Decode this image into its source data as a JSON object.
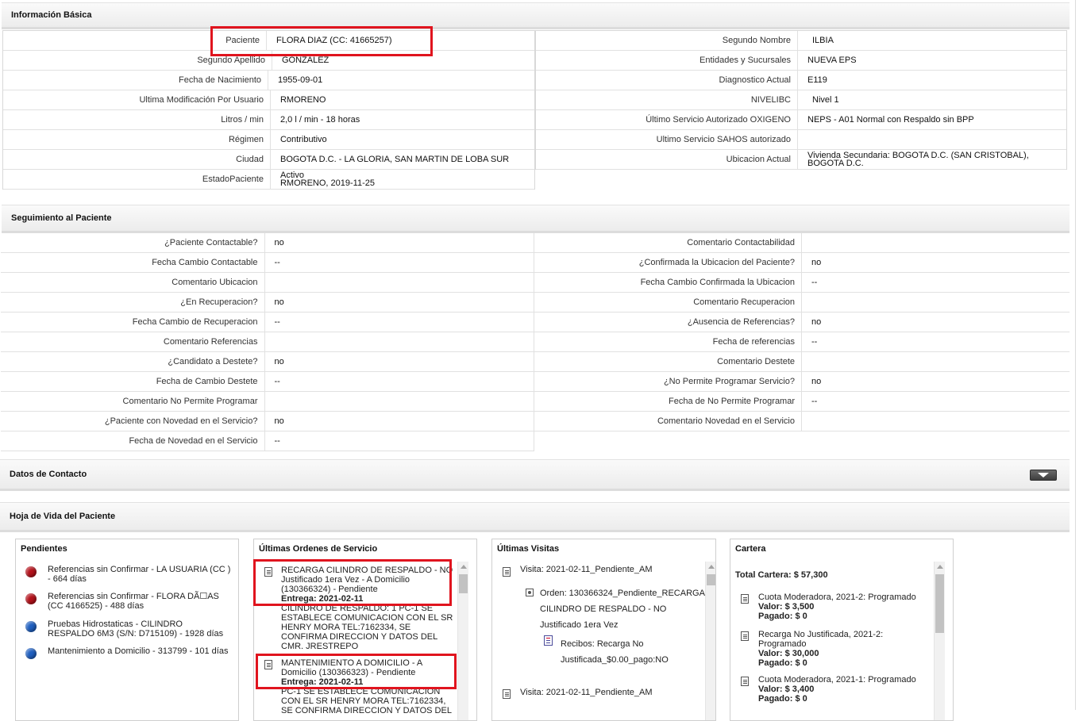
{
  "sections": {
    "basic_info": "Información Básica",
    "follow_up": "Seguimiento al Paciente",
    "contact": "Datos de Contacto",
    "history": "Hoja de Vida del Paciente"
  },
  "basic_info": {
    "left": [
      {
        "label": "Paciente",
        "value": "FLORA DIAZ (CC: 41665257)"
      },
      {
        "label": "Segundo Apellido",
        "value": "GONZALEZ"
      },
      {
        "label": "Fecha de Nacimiento",
        "value": "1955-09-01"
      },
      {
        "label": "Ultima Modificación Por Usuario",
        "value": "RMORENO"
      },
      {
        "label": "Litros / min",
        "value": "2,0 l / min - 18 horas"
      },
      {
        "label": "Régimen",
        "value": "Contributivo"
      },
      {
        "label": "Ciudad",
        "value": "BOGOTA D.C. - LA GLORIA, SAN MARTIN DE LOBA SUR"
      },
      {
        "label": "EstadoPaciente",
        "value_line1": "Activo",
        "value_line2": "RMORENO, 2019-11-25"
      }
    ],
    "right": [
      {
        "label": "Segundo Nombre",
        "value": "ILBIA"
      },
      {
        "label": "Entidades y Sucursales",
        "value": "NUEVA EPS"
      },
      {
        "label": "Diagnostico Actual",
        "value": "E119"
      },
      {
        "label": "NIVELIBC",
        "value": "Nivel 1"
      },
      {
        "label": "Último Servicio Autorizado OXIGENO",
        "value": "NEPS - A01 Normal con Respaldo sin BPP"
      },
      {
        "label": "Ultimo Servicio SAHOS autorizado",
        "value": ""
      },
      {
        "label": "Ubicacion Actual",
        "value_line1": "Vivienda Secundaria: BOGOTA D.C. (SAN CRISTOBAL),",
        "value_line2": "BOGOTA D.C."
      }
    ]
  },
  "follow_up": {
    "left": [
      {
        "label": "¿Paciente Contactable?",
        "value": "no"
      },
      {
        "label": "Fecha Cambio Contactable",
        "value": "--"
      },
      {
        "label": "Comentario Ubicacion",
        "value": ""
      },
      {
        "label": "¿En Recuperacion?",
        "value": "no"
      },
      {
        "label": "Fecha Cambio de Recuperacion",
        "value": "--"
      },
      {
        "label": "Comentario Referencias",
        "value": ""
      },
      {
        "label": "¿Candidato a Destete?",
        "value": "no"
      },
      {
        "label": "Fecha de Cambio Destete",
        "value": "--"
      },
      {
        "label": "Comentario No Permite Programar",
        "value": ""
      },
      {
        "label": "¿Paciente con Novedad en el Servicio?",
        "value": "no"
      },
      {
        "label": "Fecha de Novedad en el Servicio",
        "value": "--"
      }
    ],
    "right": [
      {
        "label": "Comentario Contactabilidad",
        "value": ""
      },
      {
        "label": "¿Confirmada la Ubicacion del Paciente?",
        "value": "no"
      },
      {
        "label": "Fecha Cambio Confirmada la Ubicacion",
        "value": "--"
      },
      {
        "label": "Comentario Recuperacion",
        "value": ""
      },
      {
        "label": "¿Ausencia de Referencias?",
        "value": "no"
      },
      {
        "label": "Fecha de referencias",
        "value": "--"
      },
      {
        "label": "Comentario Destete",
        "value": ""
      },
      {
        "label": "¿No Permite Programar Servicio?",
        "value": "no"
      },
      {
        "label": "Fecha de No Permite Programar",
        "value": "--"
      },
      {
        "label": "Comentario Novedad en el Servicio",
        "value": ""
      }
    ]
  },
  "cards": {
    "pendientes": {
      "title": "Pendientes",
      "items": [
        {
          "color": "#b3121b",
          "text": "Referencias sin Confirmar - LA USUARIA (CC ) - 664 días"
        },
        {
          "color": "#b3121b",
          "text": "Referencias sin Confirmar - FLORA DÃ☐AS (CC 4166525) - 488 días"
        },
        {
          "color": "#1f5fbf",
          "text": "Pruebas Hidrostaticas - CILINDRO RESPALDO 6M3 (S/N: D715109) - 1928 días"
        },
        {
          "color": "#1f5fbf",
          "text": "Mantenimiento a Domicilio - 313799 - 101 días"
        }
      ]
    },
    "ordenes": {
      "title": "Últimas Ordenes de Servicio",
      "items": [
        {
          "text": "RECARGA CILINDRO DE RESPALDO - NO Justificado 1era Vez - A Domicilio (130366324) - Pendiente",
          "delivery": "Entrega: 2021-02-11",
          "extra": "CILINDRO DE RESPALDO: 1 PC-1 SE ESTABLECE COMUNICACION CON EL SR HENRY MORA TEL:7162334, SE CONFIRMA DIRECCION Y DATOS DEL CMR. JRESTREPO"
        },
        {
          "text": "MANTENIMIENTO A DOMICILIO - A Domicilio (130366323) - Pendiente",
          "delivery": "Entrega: 2021-02-11",
          "extra": "PC-1 SE ESTABLECE COMUNICACION CON EL SR HENRY MORA TEL:7162334, SE CONFIRMA DIRECCION Y DATOS DEL"
        }
      ]
    },
    "visitas": {
      "title": "Últimas Visitas",
      "visit1": "Visita: 2021-02-11_Pendiente_AM",
      "order_line1": "Orden: 130366324_Pendiente_RECARGA",
      "order_line2": "CILINDRO DE RESPALDO - NO",
      "order_line3": "Justificado 1era Vez",
      "receipt_line1": "Recibos: Recarga No",
      "receipt_line2": "Justificada_$0.00_pago:NO",
      "visit2": "Visita: 2021-02-11_Pendiente_AM"
    },
    "cartera": {
      "title": "Cartera",
      "total": "Total Cartera: $ 57,300",
      "items": [
        {
          "title": "Cuota Moderadora, 2021-2: Programado",
          "valor": "Valor: $ 3,500",
          "pagado": "Pagado: $ 0"
        },
        {
          "title": "Recarga No Justificada, 2021-2: Programado",
          "valor": "Valor: $ 30,000",
          "pagado": "Pagado: $ 0"
        },
        {
          "title": "Cuota Moderadora, 2021-1: Programado",
          "valor": "Valor: $ 3,400",
          "pagado": "Pagado: $ 0"
        }
      ]
    }
  },
  "colors": {
    "highlight": "#e0141e",
    "dot_red": "#b3121b",
    "dot_blue": "#1f5fbf"
  }
}
